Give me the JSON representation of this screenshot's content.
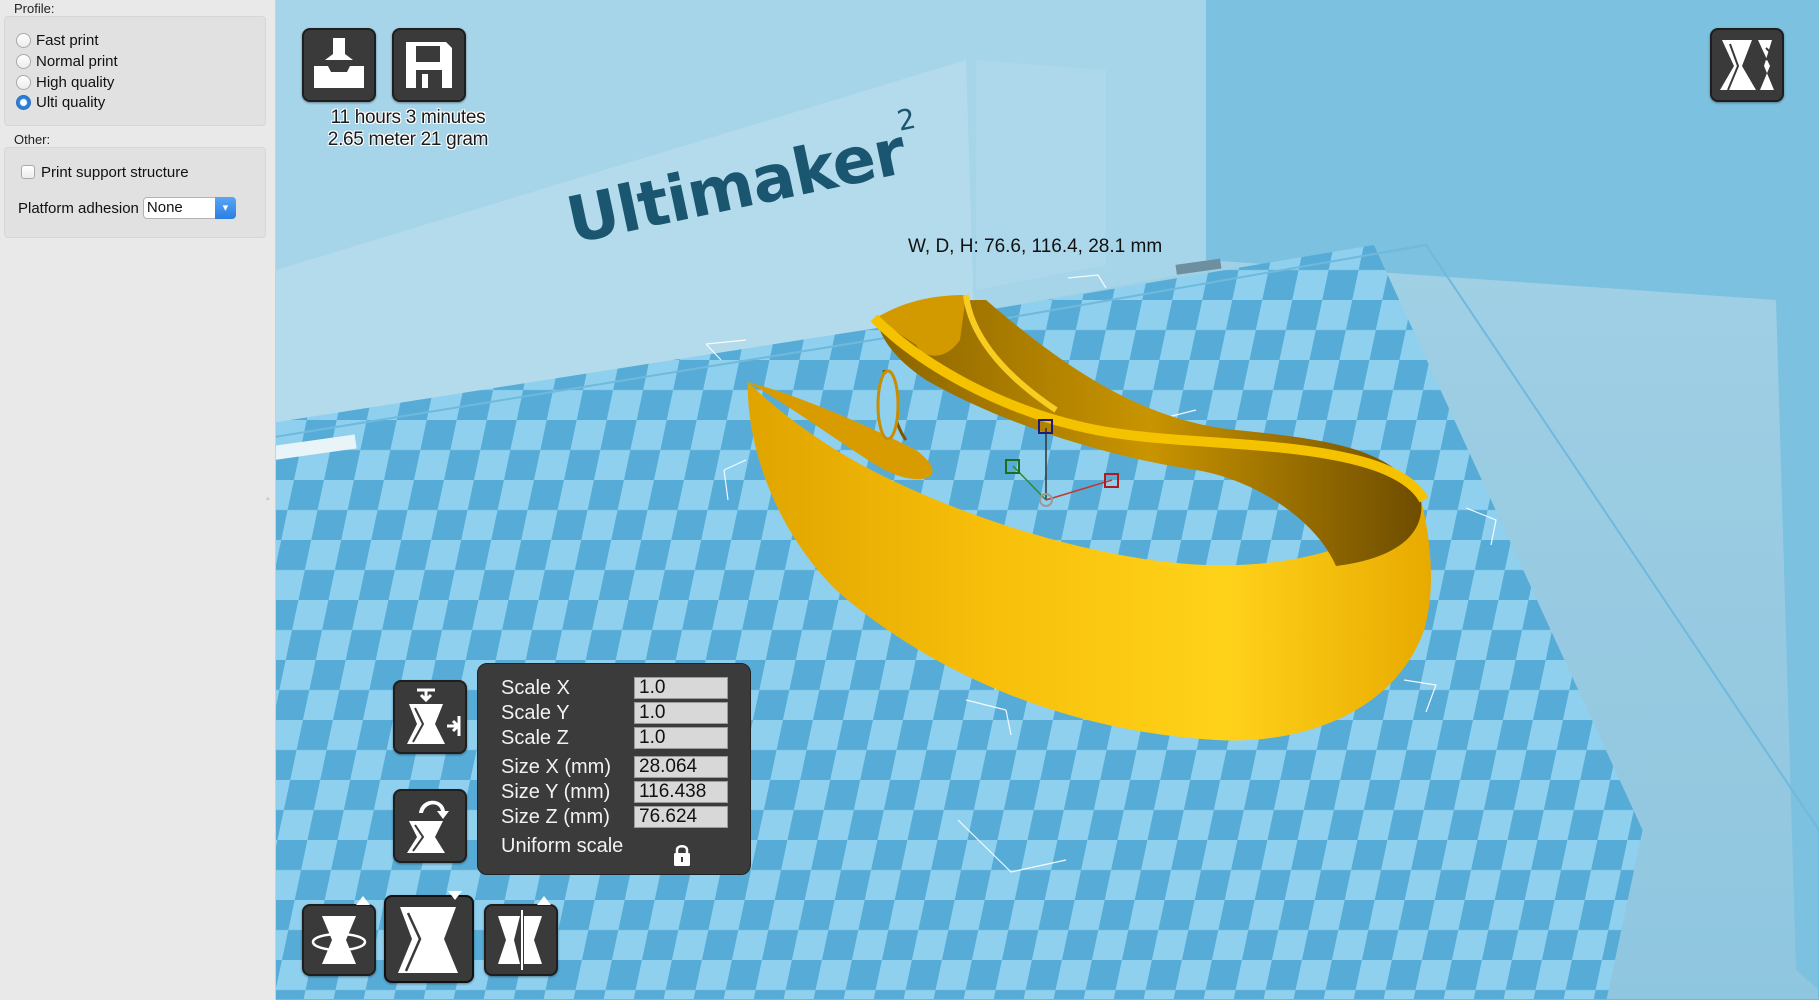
{
  "sidebar": {
    "profile_title": "Profile:",
    "profiles": [
      {
        "label": "Fast print",
        "selected": false
      },
      {
        "label": "Normal print",
        "selected": false
      },
      {
        "label": "High quality",
        "selected": false
      },
      {
        "label": "Ulti quality",
        "selected": true
      }
    ],
    "other_title": "Other:",
    "support_label": "Print support structure",
    "support_checked": false,
    "adhesion_label": "Platform adhesion",
    "adhesion_value": "None"
  },
  "viewport": {
    "brand_text": "Ultimaker",
    "brand_sup": "2",
    "print_time": "11 hours 3 minutes",
    "print_material": "2.65 meter 21 gram",
    "dimensions": "W, D, H: 76.6, 116.4, 28.1 mm",
    "colors": {
      "model": "#f5b800",
      "plate_light": "#8fd0ef",
      "plate_dark": "#56add8",
      "button": "#3a3a3a"
    }
  },
  "scale_panel": {
    "rows": [
      {
        "label": "Scale X",
        "value": "1.0"
      },
      {
        "label": "Scale Y",
        "value": "1.0"
      },
      {
        "label": "Scale Z",
        "value": "1.0"
      },
      {
        "label": "Size X (mm)",
        "value": "28.064"
      },
      {
        "label": "Size Y (mm)",
        "value": "116.438"
      },
      {
        "label": "Size Z (mm)",
        "value": "76.624"
      }
    ],
    "uniform_label": "Uniform scale"
  },
  "icons": {
    "load": "load-model-icon",
    "save": "save-icon",
    "view_mode": "view-mode-icon",
    "lay_flat": "lay-flat-icon",
    "reset_rotation": "reset-rotation-icon",
    "rotate": "rotate-icon",
    "scale": "scale-icon",
    "mirror": "mirror-icon",
    "lock": "lock-icon"
  }
}
